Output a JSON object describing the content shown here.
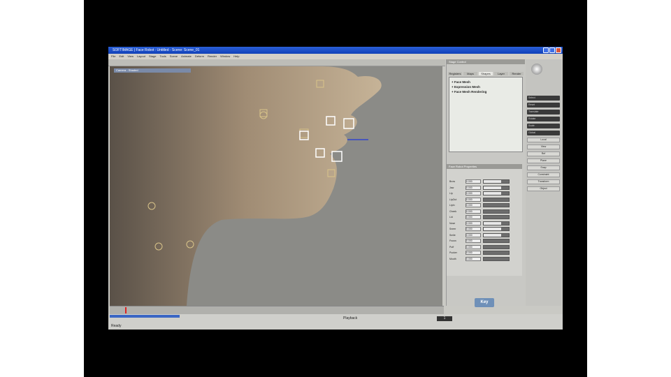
{
  "window": {
    "title": "SOFTIMAGE | Face Robot : Untitled - Scene: Scene_01"
  },
  "menu": [
    "File",
    "Edit",
    "View",
    "Layout",
    "Stage",
    "Tools",
    "Scene",
    "Animate",
    "Deform",
    "Render",
    "Window",
    "Help"
  ],
  "viewport": {
    "label": "Camera - Shaded"
  },
  "right_panel": {
    "title": "Stage Control",
    "tabs": [
      "Registers",
      "Maps",
      "Shapes",
      "Layer",
      "Render"
    ],
    "active_tab": 2,
    "items": [
      "Face Mesh",
      "Expression Mesh",
      "Face Mesh Rendering"
    ],
    "props_title": "Face Robot Properties",
    "key_label": "Key"
  },
  "params": [
    "Brow",
    "Jaw",
    "Lip",
    "LipOut",
    "LipIn",
    "Cheek",
    "Lid",
    "Nose",
    "Sneer",
    "Smile",
    "Frown",
    "Puff",
    "Pucker",
    "Mouth"
  ],
  "params_values": [
    "0.000",
    "0.000",
    "0.000",
    "0.000",
    "0.000",
    "0.000",
    "0.000",
    "0.000",
    "0.000",
    "0.000",
    "0.000",
    "0.000",
    "0.000",
    "0.000"
  ],
  "tools": [
    "Select",
    "Reset",
    "Translate",
    "Rotate",
    "Scale",
    "Global",
    "Local",
    "View",
    "Ref",
    "Plane",
    "Snap",
    "Constraint",
    "Transform",
    "Object"
  ],
  "bottom": {
    "playback": "Playback",
    "frame": "1",
    "status": "Ready"
  }
}
